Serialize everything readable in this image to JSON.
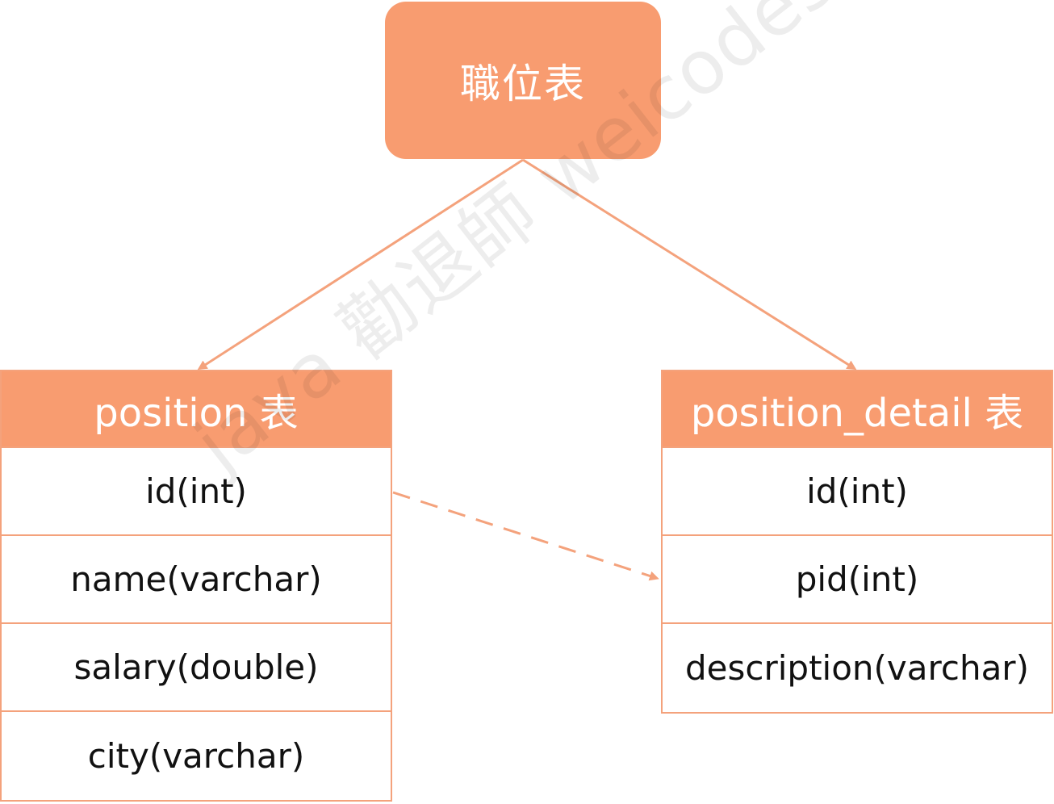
{
  "root": {
    "label": "職位表"
  },
  "tables": {
    "position": {
      "title": "position 表",
      "columns": [
        "id(int)",
        "name(varchar)",
        "salary(double)",
        "city(varchar)"
      ]
    },
    "position_detail": {
      "title": "position_detail 表",
      "columns": [
        "id(int)",
        "pid(int)",
        "description(varchar)"
      ]
    }
  },
  "watermark": "java 勸退師 weicodes.com",
  "colors": {
    "accent": "#f89c70",
    "border": "#f4a27c",
    "text": "#111111",
    "header_text": "#ffffff"
  }
}
